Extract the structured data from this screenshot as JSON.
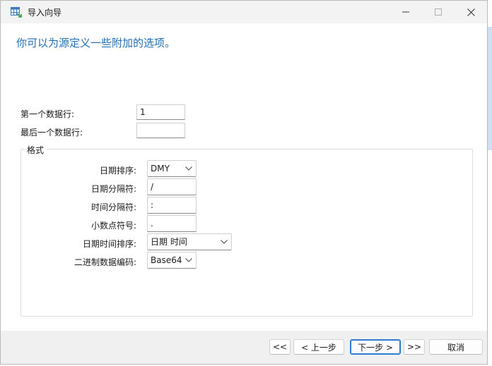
{
  "window": {
    "title": "导入向导",
    "icon": "table-import-icon"
  },
  "heading": "你可以为源定义一些附加的选项。",
  "rows": {
    "first_row_label": "第一个数据行:",
    "first_row_value": "1",
    "last_row_label": "最后一个数据行:",
    "last_row_value": ""
  },
  "format": {
    "group_title": "格式",
    "date_order_label": "日期排序:",
    "date_order_value": "DMY",
    "date_sep_label": "日期分隔符:",
    "date_sep_value": "/",
    "time_sep_label": "时间分隔符:",
    "time_sep_value": ":",
    "decimal_label": "小数点符号:",
    "decimal_value": ".",
    "datetime_order_label": "日期时间排序:",
    "datetime_order_value": "日期 时间",
    "binary_label": "二进制数据编码:",
    "binary_value": "Base64"
  },
  "footer": {
    "first_label": "<<",
    "prev_label": "< 上一步",
    "next_label": "下一步 >",
    "last_label": ">>",
    "cancel_label": "取消"
  },
  "colors": {
    "heading": "#1f6fb5",
    "primary_border": "#2f7bd3"
  }
}
